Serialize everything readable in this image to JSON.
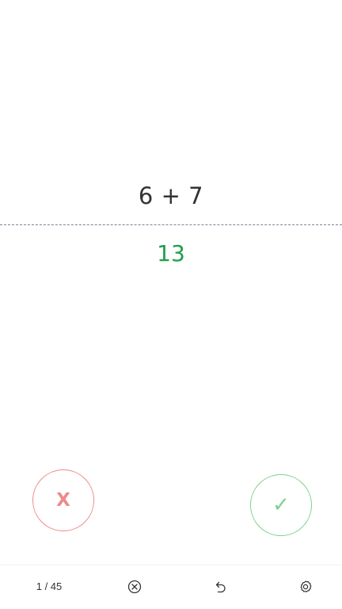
{
  "card": {
    "question": "6 + 7",
    "answer": "13"
  },
  "actions": {
    "wrong_label": "X",
    "right_label": "✓"
  },
  "bottom_bar": {
    "progress": "1 / 45",
    "icons": [
      "circle-x-icon",
      "undo-icon",
      "gear-icon"
    ]
  },
  "colors": {
    "question_text": "#333333",
    "answer_text": "#1e9e4a",
    "wrong_accent": "#ee8a8a",
    "right_accent": "#7fd08f",
    "divider": "#7f7f99",
    "icon": "#333333"
  }
}
